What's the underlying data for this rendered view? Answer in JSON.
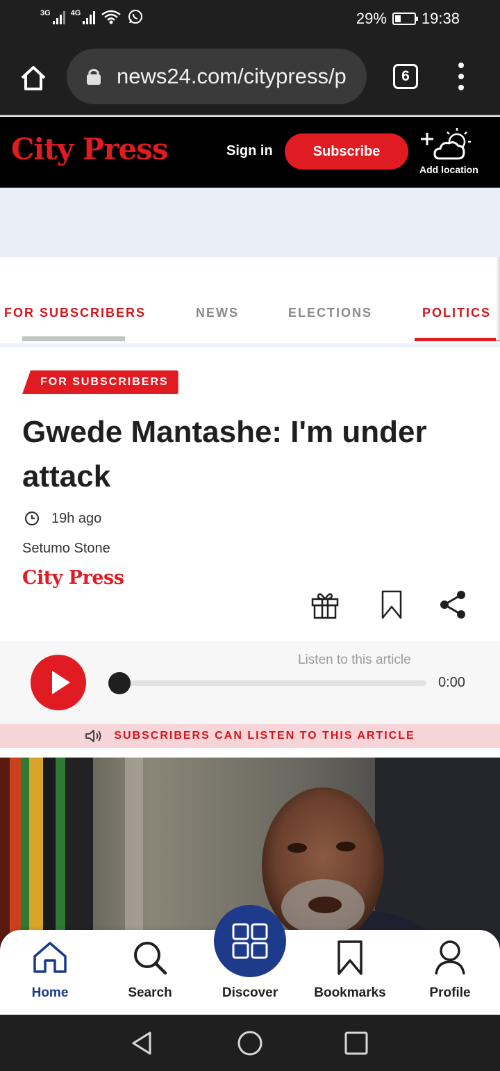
{
  "status_bar": {
    "net1": "3G",
    "net2": "4G",
    "battery_text": "29%",
    "battery_level": 0.29,
    "time": "19:38"
  },
  "browser": {
    "url": "news24.com/citypress/p",
    "tab_count": "6"
  },
  "header": {
    "logo": "City Press",
    "sign_in": "Sign in",
    "subscribe": "Subscribe",
    "add_location": "Add location"
  },
  "nav_tabs": {
    "tab1": "FOR SUBSCRIBERS",
    "tab2": "NEWS",
    "tab3": "ELECTIONS",
    "tab4": "POLITICS",
    "active": "POLITICS"
  },
  "article": {
    "badge": "FOR SUBSCRIBERS",
    "headline": "Gwede Mantashe: I'm under attack",
    "time_ago": "19h ago",
    "author": "Setumo Stone",
    "source": "City Press"
  },
  "player": {
    "label": "Listen to this article",
    "time": "0:00",
    "progress": 0,
    "banner": "SUBSCRIBERS CAN LISTEN TO THIS ARTICLE"
  },
  "bottom_nav": {
    "home": "Home",
    "search": "Search",
    "discover": "Discover",
    "bookmarks": "Bookmarks",
    "profile": "Profile",
    "active": "Home"
  },
  "colors": {
    "brand_red": "#e11b22",
    "discover_blue": "#1e3a8a",
    "active_nav": "#1b3a8c"
  }
}
